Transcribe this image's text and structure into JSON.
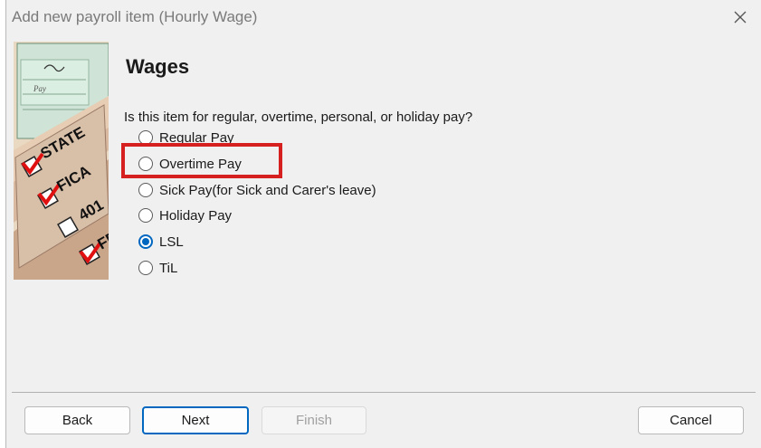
{
  "window": {
    "title": "Add new payroll item (Hourly Wage)"
  },
  "page": {
    "heading": "Wages",
    "question": "Is this item for regular, overtime, personal, or holiday pay?"
  },
  "options": [
    {
      "label": "Regular Pay",
      "selected": false
    },
    {
      "label": "Overtime Pay",
      "selected": false
    },
    {
      "label": "Sick Pay(for Sick and Carer's leave)",
      "selected": false
    },
    {
      "label": "Holiday Pay",
      "selected": false
    },
    {
      "label": "LSL",
      "selected": true
    },
    {
      "label": "TiL",
      "selected": false
    }
  ],
  "side_image": {
    "labels": [
      "STATE",
      "FICA",
      "401",
      "FE",
      "Pay"
    ]
  },
  "buttons": {
    "back": "Back",
    "next": "Next",
    "finish": "Finish",
    "cancel": "Cancel"
  },
  "colors": {
    "accent": "#0067c0",
    "highlight": "#d62020"
  }
}
